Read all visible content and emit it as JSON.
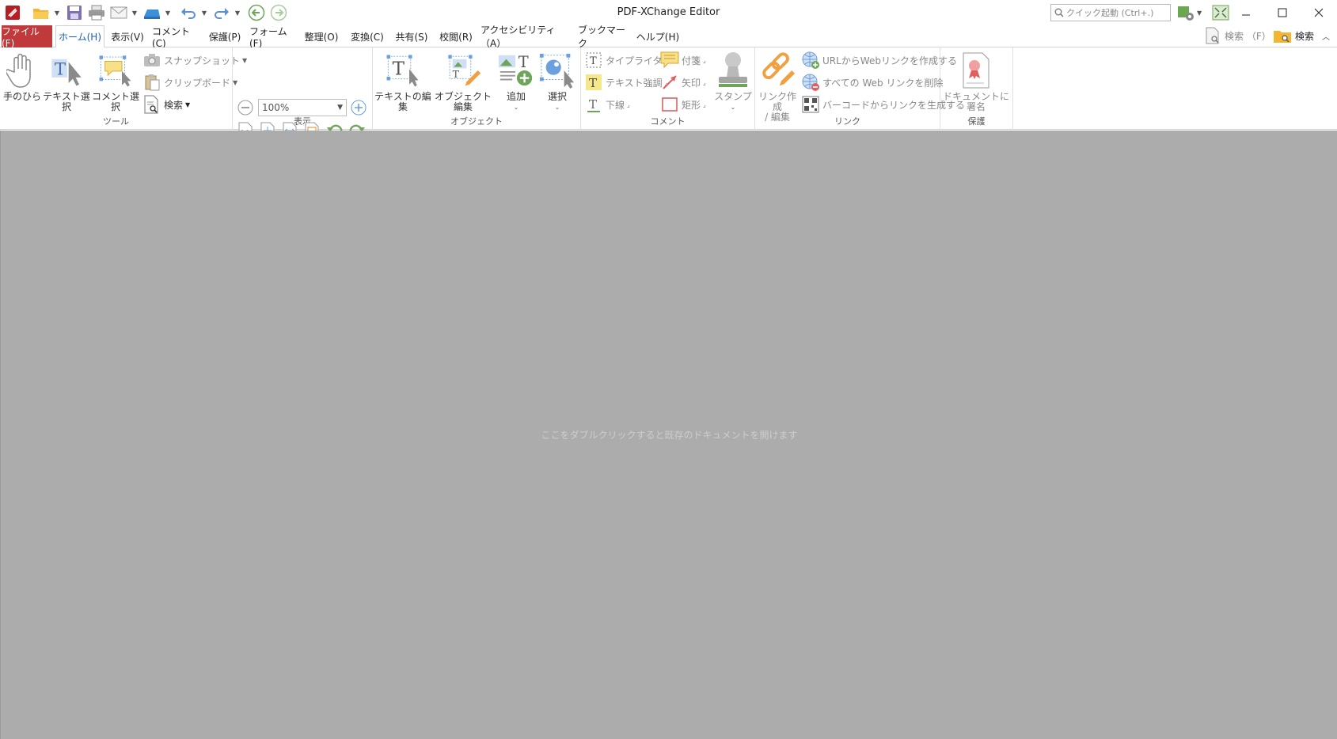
{
  "window": {
    "title": "PDF-XChange Editor"
  },
  "quick_launch": {
    "placeholder": "クイック起動 (Ctrl+.)"
  },
  "menu": {
    "tabs": [
      "ファイル(F)",
      "ホーム(H)",
      "表示(V)",
      "コメント(C)",
      "保護(P)",
      "フォーム(F)",
      "整理(O)",
      "変換(C)",
      "共有(S)",
      "校閲(R)",
      "アクセシビリティ（A）",
      "ブックマーク",
      "ヘルプ(H)"
    ],
    "find_label": "検索 （F）",
    "search_label": "検索"
  },
  "ribbon": {
    "tools": {
      "label": "ツール",
      "hand": "手のひら",
      "select_text": "テキスト選択",
      "select_comments": "コメント選択",
      "snapshot": "スナップショット",
      "clipboard": "クリップボード",
      "find": "検索"
    },
    "view": {
      "label": "表示",
      "zoom": "100%"
    },
    "objects": {
      "label": "オブジェクト",
      "edit_text": "テキストの編集",
      "edit_object": "オブジェクト編集",
      "add": "追加",
      "select": "選択"
    },
    "comment": {
      "label": "コメント",
      "typewriter": "タイプライター",
      "highlight": "テキスト強調",
      "underline": "下線",
      "sticky": "付箋",
      "arrow": "矢印",
      "rectangle": "矩形",
      "stamp": "スタンプ"
    },
    "links": {
      "label": "リンク",
      "create_edit": "リンク作成\n/ 編集",
      "create_from_url": "URLからWebリンクを作成する",
      "remove_all": "すべての Web リンクを削除",
      "from_barcode": "バーコードからリンクを生成する"
    },
    "protect": {
      "label": "保護",
      "sign": "ドキュメントに署名"
    }
  },
  "workspace": {
    "hint": "ここをダブルクリックすると既存のドキュメントを開けます"
  },
  "colors": {
    "file_tab": "#c0393b",
    "active_tab_text": "#1a5fb4",
    "workspace": "#acacac"
  }
}
